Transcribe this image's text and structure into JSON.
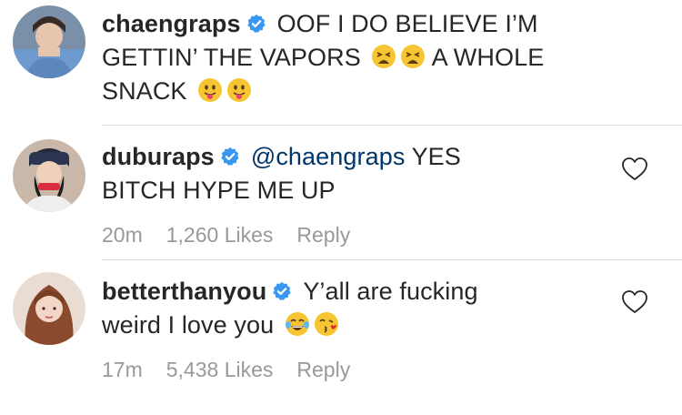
{
  "comments": [
    {
      "username": "chaengraps",
      "verified": true,
      "text": "OOF I DO BELIEVE I’M GETTIN’ THE VAPORS",
      "text2": "A WHOLE",
      "text3": "SNACK",
      "emojis": [
        "tired-face",
        "tired-face",
        "tongue-face",
        "tongue-face"
      ]
    },
    {
      "username": "duburaps",
      "verified": true,
      "mention": "@chaengraps",
      "text": "YES",
      "text2": "BITCH HYPE ME UP",
      "time": "20m",
      "likes": "1,260 Likes",
      "reply": "Reply"
    },
    {
      "username": "betterthanyou",
      "verified": true,
      "text": "Y’all are fucking",
      "text2": "weird I love you",
      "emojis": [
        "tears-of-joy-face",
        "kissing-face"
      ],
      "time": "17m",
      "likes": "5,438 Likes",
      "reply": "Reply"
    }
  ],
  "colors": {
    "verified_blue": "#3897f0",
    "mention": "#003569",
    "meta_gray": "#999999",
    "divider": "#dbdbdb",
    "text": "#262626"
  }
}
